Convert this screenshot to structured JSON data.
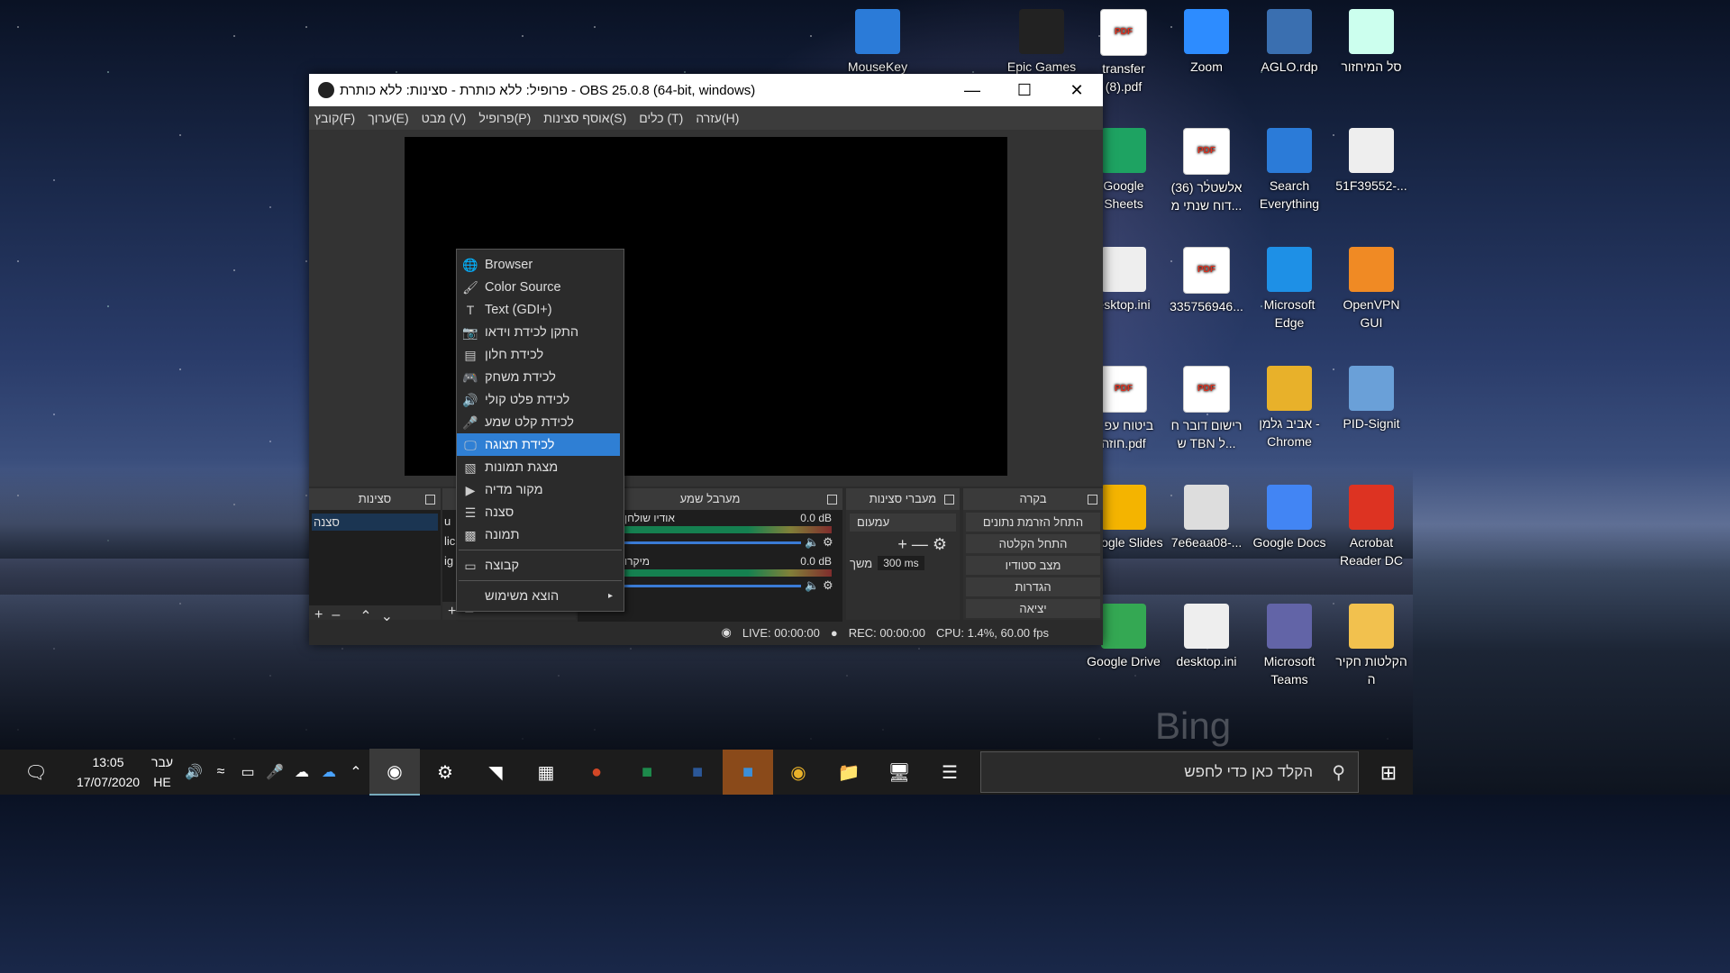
{
  "desktop": {
    "icons": [
      {
        "label": "MouseKey",
        "icon": "app-icon"
      },
      {
        "label": "Epic Games",
        "icon": "epic-icon"
      },
      {
        "label": "transfer (8).pdf",
        "icon": "pdf-icon"
      },
      {
        "label": "Zoom",
        "icon": "zoom-icon"
      },
      {
        "label": "AGLO.rdp",
        "icon": "rdp-icon"
      },
      {
        "label": "סל המיחזור",
        "icon": "recycle-bin-icon"
      },
      {
        "label": "Google Sheets",
        "icon": "sheets-icon"
      },
      {
        "label": "אלשטלר (36) דוח שנתי מ...",
        "icon": "pdf-icon"
      },
      {
        "label": "Search Everything",
        "icon": "search-everything-icon"
      },
      {
        "label": "51F39552-...",
        "icon": "file-icon"
      },
      {
        "label": "esktop.ini",
        "icon": "file-icon"
      },
      {
        "label": "335756946...",
        "icon": "pdf-icon"
      },
      {
        "label": "Microsoft Edge",
        "icon": "edge-icon"
      },
      {
        "label": "OpenVPN GUI",
        "icon": "openvpn-icon"
      },
      {
        "label": "ביטוח עפ 3 חוזה.pdf",
        "icon": "pdf-icon"
      },
      {
        "label": "רישום דובר ח ש TBN ל...",
        "icon": "pdf-icon"
      },
      {
        "label": "אביב גלמן - Chrome",
        "icon": "chrome-icon"
      },
      {
        "label": "PID-Signit",
        "icon": "signit-icon"
      },
      {
        "label": "Google Slides",
        "icon": "slides-icon"
      },
      {
        "label": "7e6eaa08-...",
        "icon": "media-icon"
      },
      {
        "label": "Google Docs",
        "icon": "docs-icon"
      },
      {
        "label": "Acrobat Reader DC",
        "icon": "acrobat-icon"
      },
      {
        "label": "Google Drive",
        "icon": "drive-icon"
      },
      {
        "label": "desktop.ini",
        "icon": "file-icon"
      },
      {
        "label": "Microsoft Teams",
        "icon": "teams-icon"
      },
      {
        "label": "הקלטות חקיר ה",
        "icon": "folder-icon"
      }
    ],
    "bing_watermark": "Bing"
  },
  "obs": {
    "title": "פרופיל: ללא כותרת - סצינות: ללא כותרת - OBS 25.0.8 (64-bit, windows)",
    "menu": [
      "קובץ(F)",
      "ערוך(E)",
      "מבט (V)",
      "פרופיל(P)",
      "אוסף סצינות(S)",
      "כלים (T)",
      "עזרה(H)"
    ],
    "docks": {
      "scenes": {
        "title": "סצינות",
        "items": [
          "סצנה"
        ]
      },
      "sources": {
        "partial": [
          "u",
          "lic",
          "ig"
        ]
      },
      "mixer": {
        "title": "מערבל שמע",
        "channels": [
          {
            "name": "אודיו שולחן",
            "db": "0.0 dB"
          },
          {
            "name": "מיקרו",
            "db": "0.0 dB"
          }
        ]
      },
      "transitions": {
        "title": "מעברי סצינות",
        "selected": "עמעום",
        "duration_label": "משך",
        "duration": "300 ms"
      },
      "controls": {
        "title": "בקרה",
        "buttons": [
          "התחל הזרמת נתונים",
          "התחל הקלטה",
          "מצב סטודיו",
          "הגדרות",
          "יציאה"
        ]
      }
    },
    "status": {
      "live": "LIVE: 00:00:00",
      "rec": "REC: 00:00:00",
      "cpu": "CPU: 1.4%, 60.00 fps"
    },
    "context_menu": [
      {
        "label": "Browser",
        "icon": "globe-icon"
      },
      {
        "label": "Color Source",
        "icon": "brush-icon"
      },
      {
        "label": "Text (GDI+)",
        "icon": "text-icon"
      },
      {
        "label": "התקן לכידת וידאו",
        "icon": "camera-icon"
      },
      {
        "label": "לכידת חלון",
        "icon": "window-icon"
      },
      {
        "label": "לכידת משחק",
        "icon": "gamepad-icon"
      },
      {
        "label": "לכידת פלט קולי",
        "icon": "speaker-icon"
      },
      {
        "label": "לכידת קלט שמע",
        "icon": "microphone-icon"
      },
      {
        "label": "לכידת תצוגה",
        "icon": "monitor-icon",
        "selected": true
      },
      {
        "label": "מצגת תמונות",
        "icon": "slideshow-icon"
      },
      {
        "label": "מקור מדיה",
        "icon": "play-icon"
      },
      {
        "label": "סצנה",
        "icon": "list-icon"
      },
      {
        "label": "תמונה",
        "icon": "image-icon"
      },
      {
        "label": "קבוצה",
        "icon": "folder-icon"
      },
      {
        "label": "הוצא משימוש",
        "icon": "",
        "submenu": true
      }
    ]
  },
  "taskbar": {
    "search_placeholder": "הקלד כאן כדי לחפש",
    "clock_time": "13:05",
    "clock_date": "17/07/2020",
    "lang_top": "עבר",
    "lang_bottom": "HE"
  }
}
